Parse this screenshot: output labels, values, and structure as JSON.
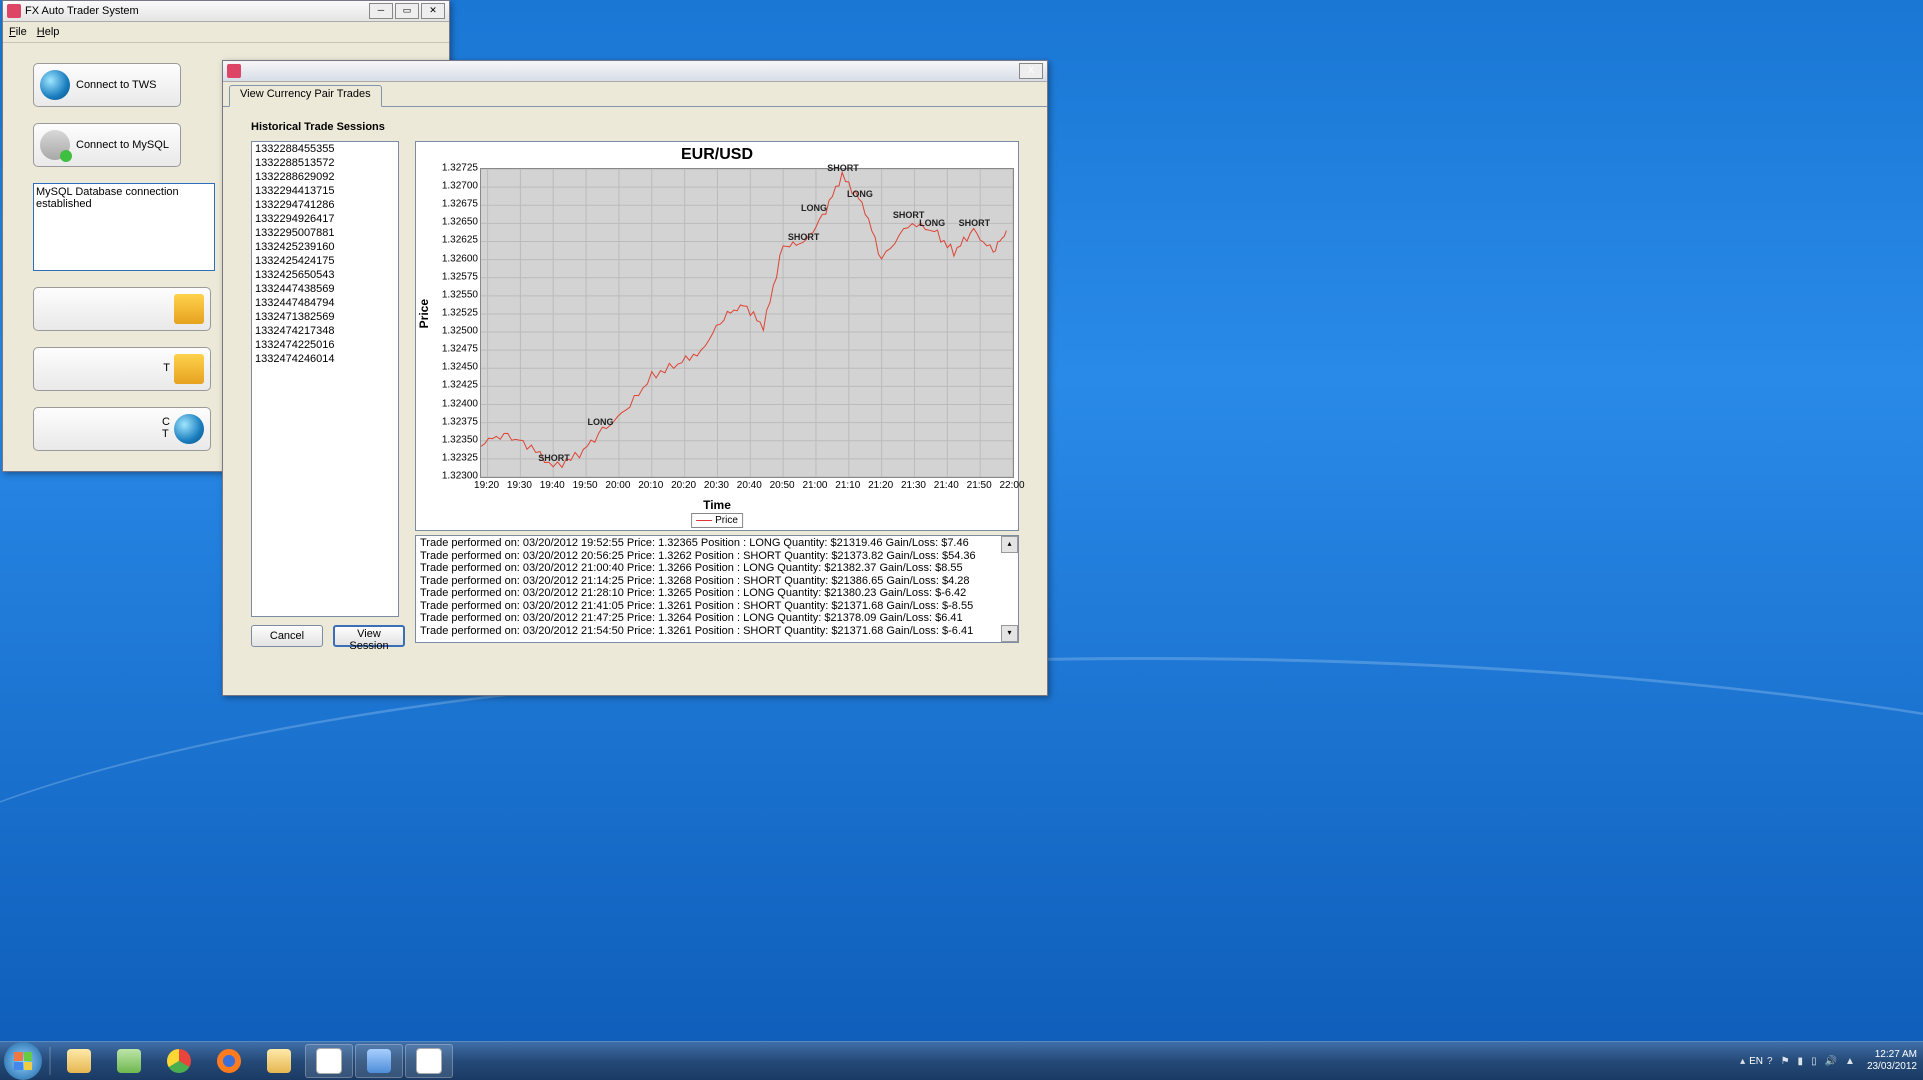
{
  "main_window": {
    "title": "FX Auto Trader System",
    "menu": {
      "file": "File",
      "help": "Help"
    },
    "btn_tws": "Connect to TWS",
    "btn_mysql": "Connect to MySQL",
    "log_msg": "MySQL Database connection established"
  },
  "dialog": {
    "tab": "View Currency Pair Trades",
    "hts_label": "Historical Trade Sessions",
    "sessions": [
      "1332288455355",
      "1332288513572",
      "1332288629092",
      "1332294413715",
      "1332294741286",
      "1332294926417",
      "1332295007881",
      "1332425239160",
      "1332425424175",
      "1332425650543",
      "1332447438569",
      "1332447484794",
      "1332471382569",
      "1332474217348",
      "1332474225016",
      "1332474246014"
    ],
    "btn_cancel": "Cancel",
    "btn_view": "View Session",
    "trade_log": [
      "Trade performed on: 03/20/2012 19:52:55 Price: 1.32365 Position : LONG Quantity: $21319.46 Gain/Loss: $7.46",
      "Trade performed on: 03/20/2012 20:56:25 Price: 1.3262 Position : SHORT Quantity: $21373.82 Gain/Loss: $54.36",
      "Trade performed on: 03/20/2012 21:00:40 Price: 1.3266 Position : LONG Quantity: $21382.37 Gain/Loss: $8.55",
      "Trade performed on: 03/20/2012 21:14:25 Price: 1.3268 Position : SHORT Quantity: $21386.65 Gain/Loss: $4.28",
      "Trade performed on: 03/20/2012 21:28:10 Price: 1.3265 Position : LONG Quantity: $21380.23 Gain/Loss: $-6.42",
      "Trade performed on: 03/20/2012 21:41:05 Price: 1.3261 Position : SHORT Quantity: $21371.68 Gain/Loss: $-8.55",
      "Trade performed on: 03/20/2012 21:47:25 Price: 1.3264 Position : LONG Quantity: $21378.09 Gain/Loss: $6.41",
      "Trade performed on: 03/20/2012 21:54:50 Price: 1.3261 Position : SHORT Quantity: $21371.68 Gain/Loss: $-6.41"
    ]
  },
  "chart_data": {
    "type": "line",
    "title": "EUR/USD",
    "xlabel": "Time",
    "ylabel": "Price",
    "ylim": [
      1.323,
      1.32725
    ],
    "yticks": [
      "1.32725",
      "1.32700",
      "1.32675",
      "1.32650",
      "1.32625",
      "1.32600",
      "1.32575",
      "1.32550",
      "1.32525",
      "1.32500",
      "1.32475",
      "1.32450",
      "1.32425",
      "1.32400",
      "1.32375",
      "1.32350",
      "1.32325",
      "1.32300"
    ],
    "xticks": [
      "19:20",
      "19:30",
      "19:40",
      "19:50",
      "20:00",
      "20:10",
      "20:20",
      "20:30",
      "20:40",
      "20:50",
      "21:00",
      "21:10",
      "21:20",
      "21:30",
      "21:40",
      "21:50",
      "22:00"
    ],
    "series": [
      {
        "name": "Price",
        "x": [
          "19:18",
          "19:25",
          "19:32",
          "19:40",
          "19:48",
          "19:55",
          "20:02",
          "20:10",
          "20:18",
          "20:25",
          "20:32",
          "20:38",
          "20:44",
          "20:50",
          "20:56",
          "21:02",
          "21:08",
          "21:14",
          "21:20",
          "21:28",
          "21:36",
          "21:42",
          "21:48",
          "21:54",
          "21:58"
        ],
        "y": [
          1.32345,
          1.3236,
          1.32345,
          1.32315,
          1.3233,
          1.32365,
          1.3239,
          1.3244,
          1.32455,
          1.32475,
          1.3252,
          1.3254,
          1.32505,
          1.3262,
          1.3262,
          1.3266,
          1.32715,
          1.3268,
          1.326,
          1.3265,
          1.3264,
          1.3261,
          1.3264,
          1.3261,
          1.3264
        ]
      }
    ],
    "annotations": [
      {
        "x": "19:40",
        "y": 1.32315,
        "text": "SHORT"
      },
      {
        "x": "19:55",
        "y": 1.32365,
        "text": "LONG"
      },
      {
        "x": "20:56",
        "y": 1.3262,
        "text": "SHORT"
      },
      {
        "x": "21:00",
        "y": 1.3266,
        "text": "LONG"
      },
      {
        "x": "21:08",
        "y": 1.32715,
        "text": "SHORT"
      },
      {
        "x": "21:14",
        "y": 1.3268,
        "text": "LONG"
      },
      {
        "x": "21:28",
        "y": 1.3265,
        "text": "SHORT"
      },
      {
        "x": "21:36",
        "y": 1.3264,
        "text": "LONG"
      },
      {
        "x": "21:48",
        "y": 1.3264,
        "text": "SHORT"
      }
    ],
    "legend": "Price"
  },
  "taskbar": {
    "lang": "EN",
    "time": "12:27 AM",
    "date": "23/03/2012"
  }
}
